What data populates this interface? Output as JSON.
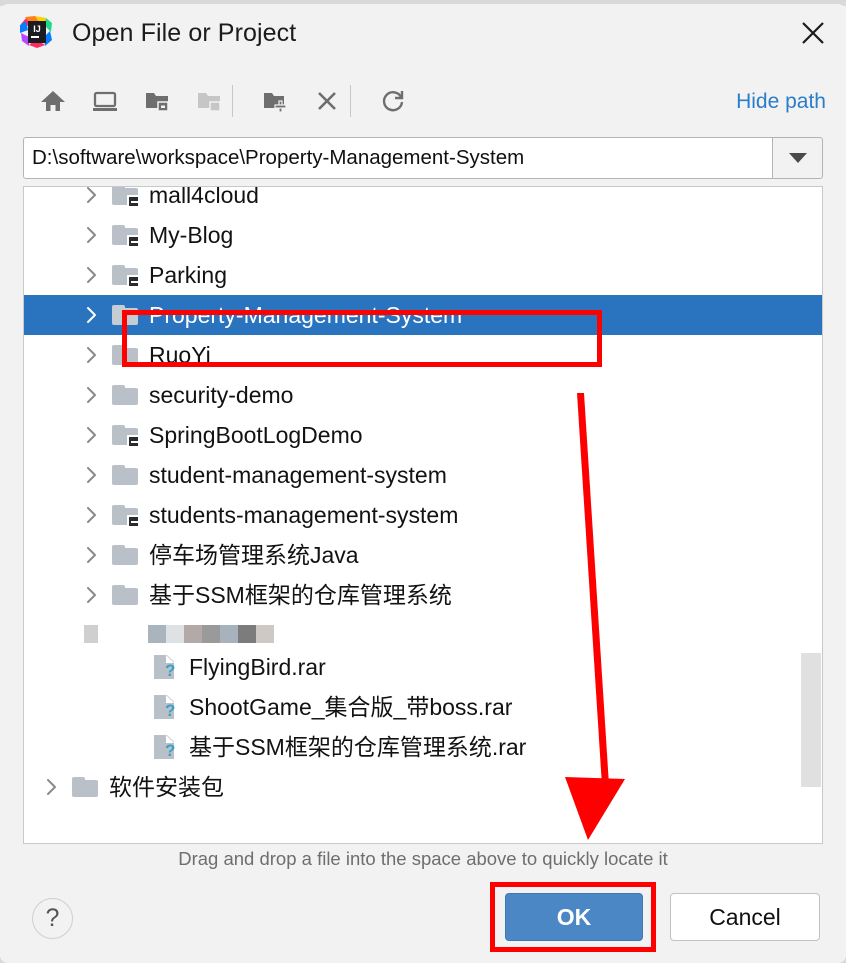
{
  "window": {
    "title": "Open File or Project",
    "app_icon": "intellij-idea-icon",
    "close_icon": "close-icon"
  },
  "toolbar": {
    "items": [
      {
        "name": "home-icon",
        "tooltip": "Home"
      },
      {
        "name": "desktop-icon",
        "tooltip": "Desktop"
      },
      {
        "name": "project-folder-icon",
        "tooltip": "Project Directory"
      },
      {
        "name": "folder-up-icon",
        "tooltip": "Up",
        "disabled": true
      },
      {
        "name": "new-folder-icon",
        "tooltip": "New Folder"
      },
      {
        "name": "delete-icon",
        "tooltip": "Delete"
      },
      {
        "name": "refresh-icon",
        "tooltip": "Refresh"
      }
    ],
    "hide_path_label": "Hide path"
  },
  "path": {
    "value": "D:\\software\\workspace\\Property-Management-System",
    "placeholder": "",
    "dropdown_icon": "chevron-down-icon"
  },
  "tree": {
    "rows": [
      {
        "label": "mall4cloud",
        "type": "folder",
        "module": true,
        "indent": 1,
        "expandable": true,
        "selected": false
      },
      {
        "label": "My-Blog",
        "type": "folder",
        "module": true,
        "indent": 1,
        "expandable": true,
        "selected": false
      },
      {
        "label": "Parking",
        "type": "folder",
        "module": true,
        "indent": 1,
        "expandable": true,
        "selected": false
      },
      {
        "label": "Property-Management-System",
        "type": "folder",
        "module": false,
        "indent": 1,
        "expandable": true,
        "selected": true
      },
      {
        "label": "RuoYi",
        "type": "folder",
        "module": false,
        "indent": 1,
        "expandable": true,
        "selected": false
      },
      {
        "label": "security-demo",
        "type": "folder",
        "module": false,
        "indent": 1,
        "expandable": true,
        "selected": false
      },
      {
        "label": "SpringBootLogDemo",
        "type": "folder",
        "module": true,
        "indent": 1,
        "expandable": true,
        "selected": false
      },
      {
        "label": "student-management-system",
        "type": "folder",
        "module": false,
        "indent": 1,
        "expandable": true,
        "selected": false
      },
      {
        "label": "students-management-system",
        "type": "folder",
        "module": true,
        "indent": 1,
        "expandable": true,
        "selected": false
      },
      {
        "label": "停车场管理系统Java",
        "type": "folder",
        "module": false,
        "indent": 1,
        "expandable": true,
        "selected": false
      },
      {
        "label": "基于SSM框架的仓库管理系统",
        "type": "folder",
        "module": false,
        "indent": 1,
        "expandable": true,
        "selected": false
      },
      {
        "label": "",
        "type": "redacted",
        "module": false,
        "indent": 1,
        "expandable": false,
        "selected": false
      },
      {
        "label": "FlyingBird.rar",
        "type": "file",
        "module": false,
        "indent": 2,
        "expandable": false,
        "selected": false
      },
      {
        "label": "ShootGame_集合版_带boss.rar",
        "type": "file",
        "module": false,
        "indent": 2,
        "expandable": false,
        "selected": false
      },
      {
        "label": "基于SSM框架的仓库管理系统.rar",
        "type": "file",
        "module": false,
        "indent": 2,
        "expandable": false,
        "selected": false
      },
      {
        "label": "软件安装包",
        "type": "folder",
        "module": false,
        "indent": 0,
        "expandable": true,
        "selected": false
      }
    ],
    "scrollbar": {
      "name": "vertical-scrollbar"
    }
  },
  "hint": {
    "text": "Drag and drop a file into the space above to quickly locate it"
  },
  "buttons": {
    "help_label": "?",
    "ok_label": "OK",
    "cancel_label": "Cancel"
  },
  "annotations": {
    "selected_row_highlight": "red-rectangle",
    "ok_button_highlight": "red-rectangle",
    "pointer": "red-arrow-down"
  },
  "colors": {
    "selection_blue": "#2a74bf",
    "link_blue": "#2a7ec8",
    "ok_button_blue": "#4a87c4",
    "annotation_red": "#fe0000",
    "dialog_background": "#f2f2f2",
    "tree_background": "#ffffff",
    "folder_gray": "#b9c0c7"
  }
}
